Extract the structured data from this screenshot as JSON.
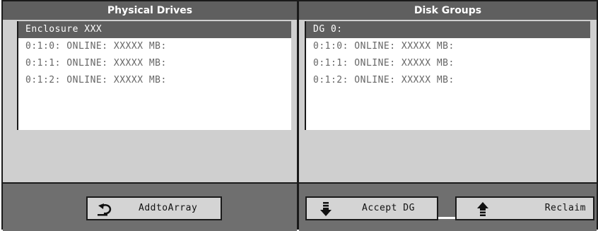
{
  "physical_drives": {
    "title": "Physical Drives",
    "items": [
      {
        "label": "Enclosure XXX",
        "selected": true
      },
      {
        "label": "0:1:0: ONLINE: XXXXX MB:",
        "selected": false
      },
      {
        "label": "0:1:1: ONLINE: XXXXX MB:",
        "selected": false
      },
      {
        "label": "0:1:2: ONLINE: XXXXX MB:",
        "selected": false
      }
    ],
    "add_button_label": "AddtoArray",
    "add_button_icon": "undo-arrow-icon"
  },
  "disk_groups": {
    "title": "Disk Groups",
    "items": [
      {
        "label": "DG 0:",
        "selected": true
      },
      {
        "label": "0:1:0: ONLINE: XXXXX MB:",
        "selected": false
      },
      {
        "label": "0:1:1: ONLINE: XXXXX MB:",
        "selected": false
      },
      {
        "label": "0:1:2: ONLINE: XXXXX MB:",
        "selected": false
      }
    ],
    "accept_button_label": "Accept DG",
    "accept_button_icon": "arrow-down-icon",
    "reclaim_button_label": "Reclaim",
    "reclaim_button_icon": "arrow-up-icon"
  },
  "colors": {
    "title_bar": "#5f5f5f",
    "selection": "#5f5f5f",
    "panel_bg": "#cfcfcf",
    "footer_bg": "#6f6f6f",
    "button_bg": "#d4d4d4"
  }
}
